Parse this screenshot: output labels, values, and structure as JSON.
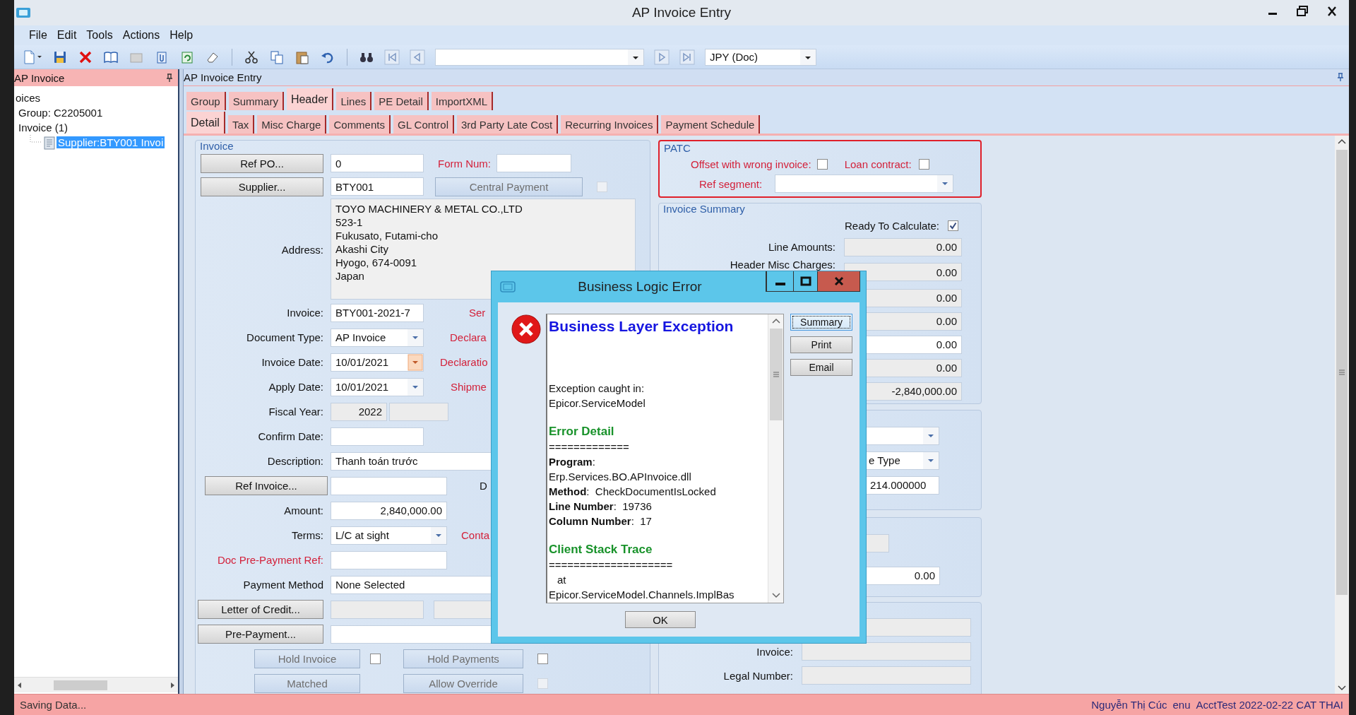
{
  "window": {
    "title": "AP Invoice Entry"
  },
  "menu": [
    {
      "label": "File"
    },
    {
      "label": "Edit"
    },
    {
      "label": "Tools"
    },
    {
      "label": "Actions"
    },
    {
      "label": "Help"
    }
  ],
  "toolbar": {
    "currency": "JPY (Doc)"
  },
  "tree_panel": {
    "title": "AP Invoice",
    "items": [
      {
        "label": "oices",
        "selected": false
      },
      {
        "label": "Group: C2205001",
        "selected": false
      },
      {
        "label": "Invoice (1)",
        "selected": false,
        "children": [
          {
            "label": "Supplier:BTY001 Invoi",
            "selected": true
          }
        ]
      }
    ]
  },
  "main_panel": {
    "title": "AP Invoice Entry"
  },
  "tabs": [
    {
      "label": "Group",
      "selected": false
    },
    {
      "label": "Summary",
      "selected": false
    },
    {
      "label": "Header",
      "selected": true
    },
    {
      "label": "Lines",
      "selected": false
    },
    {
      "label": "PE Detail",
      "selected": false
    },
    {
      "label": "ImportXML",
      "selected": false
    }
  ],
  "subtabs": [
    {
      "label": "Detail",
      "selected": true
    },
    {
      "label": "Tax",
      "selected": false
    },
    {
      "label": "Misc Charge",
      "selected": false
    },
    {
      "label": "Comments",
      "selected": false
    },
    {
      "label": "GL Control",
      "selected": false
    },
    {
      "label": "3rd Party Late Cost",
      "selected": false
    },
    {
      "label": "Recurring Invoices",
      "selected": false
    },
    {
      "label": "Payment Schedule",
      "selected": false
    }
  ],
  "invoice_group": {
    "title": "Invoice",
    "rows": [
      [
        {
          "kind": "button",
          "text": "Ref PO..."
        },
        {
          "kind": "field",
          "value": "0",
          "readonly": false
        },
        {
          "kind": "label",
          "text": "Form Num:",
          "highlighted": true
        },
        {
          "kind": "field",
          "readonly": false
        }
      ],
      [
        {
          "kind": "button",
          "text": "Supplier..."
        },
        {
          "kind": "field",
          "value": "BTY001",
          "readonly": false
        },
        {
          "kind": "toggle",
          "text": "Central Payment"
        },
        {
          "kind": "checkbox",
          "checked": false,
          "disabled": true
        }
      ],
      [
        {
          "kind": "label",
          "text": "Address:",
          "highlighted": false
        },
        {
          "kind": "textarea",
          "lines": [
            "TOYO MACHINERY & METAL CO.,LTD",
            "523-1",
            "Fukusato, Futami-cho",
            "Akashi City",
            "Hyogo, 674-0091",
            "Japan"
          ]
        }
      ],
      [
        {
          "kind": "label",
          "text": "Invoice:",
          "highlighted": false
        },
        {
          "kind": "field",
          "value": "BTY001-2021-7",
          "readonly": false
        },
        {
          "kind": "label",
          "text": "Ser",
          "highlighted": true
        }
      ],
      [
        {
          "kind": "label",
          "text": "Document Type:",
          "highlighted": false
        },
        {
          "kind": "combo",
          "value": "AP Invoice"
        },
        {
          "kind": "label",
          "text": "Declara",
          "highlighted": true
        }
      ],
      [
        {
          "kind": "label",
          "text": "Invoice Date:",
          "highlighted": false
        },
        {
          "kind": "date",
          "value": "10/01/2021"
        },
        {
          "kind": "label",
          "text": "Declaratio",
          "highlighted": true
        }
      ],
      [
        {
          "kind": "label",
          "text": "Apply Date:",
          "highlighted": false
        },
        {
          "kind": "combo",
          "value": "10/01/2021"
        },
        {
          "kind": "label",
          "text": "Shipme",
          "highlighted": true
        }
      ],
      [
        {
          "kind": "label",
          "text": "Fiscal Year:",
          "highlighted": false
        },
        {
          "kind": "number",
          "value": "2022",
          "readonly": true
        },
        {
          "kind": "field",
          "readonly": true
        }
      ],
      [
        {
          "kind": "label",
          "text": "Confirm Date:",
          "highlighted": false
        },
        {
          "kind": "field",
          "readonly": false
        }
      ],
      [
        {
          "kind": "label",
          "text": "Description:",
          "highlighted": false
        },
        {
          "kind": "field",
          "value": "Thanh toán trước",
          "readonly": false
        }
      ],
      [
        {
          "kind": "button",
          "text": "Ref Invoice..."
        },
        {
          "kind": "field",
          "readonly": false
        },
        {
          "kind": "label",
          "text": "D",
          "highlighted": false
        }
      ],
      [
        {
          "kind": "label",
          "text": "Amount:",
          "highlighted": false
        },
        {
          "kind": "number",
          "value": "2,840,000.00",
          "readonly": false
        }
      ],
      [
        {
          "kind": "label",
          "text": "Terms:",
          "highlighted": false
        },
        {
          "kind": "combo",
          "value": "L/C at sight"
        },
        {
          "kind": "label",
          "text": "Conta",
          "highlighted": true
        }
      ],
      [
        {
          "kind": "label",
          "text": "Doc Pre-Payment Ref:",
          "highlighted": true
        },
        {
          "kind": "field",
          "readonly": false
        }
      ],
      [
        {
          "kind": "label",
          "text": "Payment Method",
          "highlighted": false
        },
        {
          "kind": "field",
          "value": "None Selected",
          "readonly": false
        }
      ],
      [
        {
          "kind": "button",
          "text": "Letter of Credit..."
        },
        {
          "kind": "field",
          "readonly": true
        },
        {
          "kind": "field",
          "readonly": true
        }
      ],
      [
        {
          "kind": "button",
          "text": "Pre-Payment..."
        },
        {
          "kind": "field",
          "readonly": false
        }
      ],
      [
        {
          "kind": "toggle",
          "text": "Hold Invoice"
        },
        {
          "kind": "checkbox",
          "checked": false,
          "disabled": false
        },
        {
          "kind": "toggle",
          "text": "Hold Payments"
        },
        {
          "kind": "checkbox",
          "checked": false,
          "disabled": false
        }
      ],
      [
        {
          "kind": "toggle",
          "text": "Matched"
        },
        {
          "kind": "toggle",
          "text": "Allow Override"
        },
        {
          "kind": "checkbox",
          "checked": false,
          "disabled": true
        }
      ]
    ]
  },
  "side_groups": [
    {
      "kind": "alert",
      "title": "PATC",
      "rows": [
        [
          {
            "kind": "label",
            "text": "Offset with wrong invoice:",
            "highlighted": true
          },
          {
            "kind": "checkbox",
            "checked": false,
            "disabled": false
          },
          {
            "kind": "label",
            "text": "Loan contract:",
            "highlighted": true
          },
          {
            "kind": "checkbox",
            "checked": false,
            "disabled": false
          }
        ],
        [
          {
            "kind": "label",
            "text": "Ref segment:",
            "highlighted": true
          },
          {
            "kind": "combo"
          }
        ]
      ]
    },
    {
      "kind": "plain",
      "title": "Invoice Summary",
      "rows": [
        [
          {
            "kind": "label",
            "text": "Ready To Calculate:",
            "highlighted": false
          },
          {
            "kind": "checkbox",
            "checked": true,
            "disabled": false
          }
        ],
        [
          {
            "kind": "label",
            "text": "Line Amounts:",
            "highlighted": false
          },
          {
            "kind": "number",
            "value": "0.00",
            "readonly": true
          }
        ],
        [
          {
            "kind": "label",
            "text": "Header Misc Charges:",
            "highlighted": false
          },
          {
            "kind": "number",
            "value": "0.00",
            "readonly": true
          }
        ],
        [
          {
            "kind": "number",
            "value": "0.00",
            "readonly": true
          }
        ],
        [
          {
            "kind": "number",
            "value": "0.00",
            "readonly": true
          }
        ],
        [
          {
            "kind": "number",
            "value": "0.00",
            "readonly": false
          }
        ],
        [
          {
            "kind": "number",
            "value": "0.00",
            "readonly": true
          }
        ],
        [
          {
            "kind": "number",
            "value": "-2,840,000.00",
            "readonly": true
          }
        ]
      ]
    },
    {
      "kind": "plain",
      "rows": [
        [
          {
            "kind": "combo"
          }
        ],
        [
          {
            "kind": "combo",
            "value": "e Type"
          }
        ],
        [
          {
            "kind": "field",
            "value": "214.000000",
            "readonly": false
          }
        ]
      ]
    },
    {
      "kind": "plain",
      "rows": [
        [
          {
            "kind": "field",
            "readonly": true
          }
        ],
        [
          {
            "kind": "number",
            "value": "0.00",
            "readonly": false
          }
        ]
      ]
    },
    {
      "kind": "plain",
      "rows": [
        [
          {
            "kind": "field",
            "readonly": true
          }
        ],
        [
          {
            "kind": "label",
            "text": "Invoice:",
            "highlighted": false
          },
          {
            "kind": "field",
            "readonly": true
          }
        ],
        [
          {
            "kind": "label",
            "text": "Legal Number:",
            "highlighted": false
          },
          {
            "kind": "field",
            "readonly": true
          }
        ]
      ]
    }
  ],
  "dialog": {
    "title": "Business Logic Error",
    "lines": [
      {
        "kind": "title",
        "text": "Business Layer Exception"
      },
      {
        "kind": "text",
        "text": "Exception caught in:"
      },
      {
        "kind": "text",
        "text": "Epicor.ServiceModel"
      },
      {
        "kind": "section",
        "text": "Error Detail"
      },
      {
        "kind": "text",
        "text": "============="
      },
      {
        "kind": "text",
        "text": "**Program**:"
      },
      {
        "kind": "text",
        "text": "Erp.Services.BO.APInvoice.dll"
      },
      {
        "kind": "text",
        "text": "**Method**:  CheckDocumentIsLocked"
      },
      {
        "kind": "text",
        "text": "**Line Number**:  19736"
      },
      {
        "kind": "text",
        "text": "**Column Number**:  17"
      },
      {
        "kind": "section",
        "text": "Client Stack Trace"
      },
      {
        "kind": "text",
        "text": "===================="
      },
      {
        "kind": "indent",
        "text": "at"
      },
      {
        "kind": "text",
        "text": "Epicor.ServiceModel.Channels.ImplBas"
      }
    ],
    "buttons": [
      {
        "label": "Summary",
        "focused": true
      },
      {
        "label": "Print",
        "focused": false
      },
      {
        "label": "Email",
        "focused": false
      }
    ],
    "ok": "OK"
  },
  "status_bar": {
    "message": "Saving Data...",
    "user": "Nguyễn Thị Cúc",
    "language": "enu",
    "environment": "AcctTest 2022-02-22 CAT THAI"
  }
}
